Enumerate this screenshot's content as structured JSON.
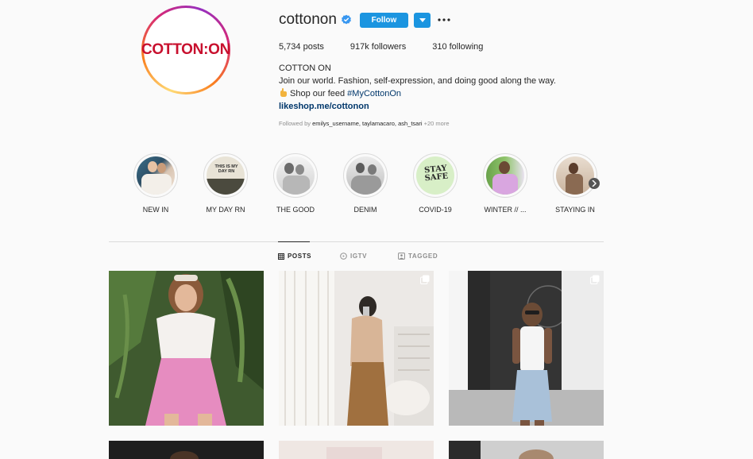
{
  "profile": {
    "username": "cottonon",
    "avatar_text": "COTTON:ON",
    "follow_label": "Follow",
    "posts": "5,734 posts",
    "followers": "917k followers",
    "following": "310 following"
  },
  "bio": {
    "name": "COTTON ON",
    "line1": "Join our world. Fashion, self-expression, and doing good along the way.",
    "line2_text": "Shop our feed ",
    "line2_hashtag": "#MyCottonOn",
    "link": "likeshop.me/cottonon",
    "followed_prefix": "Followed by ",
    "followed_users": "emilys_username, taylamacaro, ash_tsari",
    "followed_more": " +20 more"
  },
  "highlights": [
    {
      "label": "NEW IN"
    },
    {
      "label": "MY DAY RN"
    },
    {
      "label": "THE GOOD"
    },
    {
      "label": "DENIM"
    },
    {
      "label": "COVID-19"
    },
    {
      "label": "WINTER // ..."
    },
    {
      "label": "STAYING IN"
    }
  ],
  "highlight_thumb_text": {
    "my_day": "THIS IS MY DAY RN",
    "covid": "STAY SAFE"
  },
  "tabs": [
    {
      "label": "POSTS",
      "icon": "grid-icon",
      "active": true
    },
    {
      "label": "IGTV",
      "icon": "igtv-icon",
      "active": false
    },
    {
      "label": "TAGGED",
      "icon": "tagged-icon",
      "active": false
    }
  ],
  "colors": {
    "follow_blue": "#1b95e0",
    "brand_red": "#c8102e",
    "link_blue": "#00376b"
  }
}
